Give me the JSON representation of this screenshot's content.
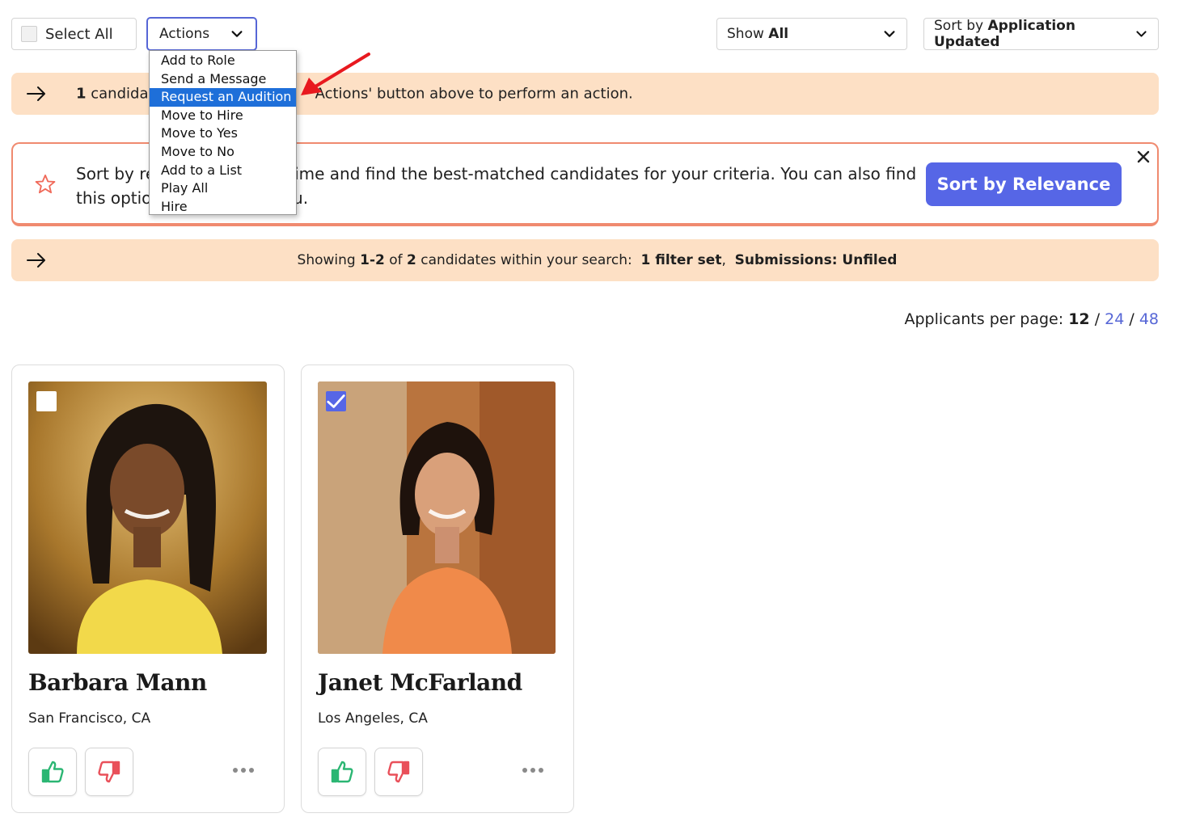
{
  "toolbar": {
    "select_all_label": "Select All",
    "actions_label": "Actions",
    "show_label_prefix": "Show ",
    "show_label_value": "All",
    "sort_label_prefix": "Sort by ",
    "sort_label_value": "Application Updated"
  },
  "actions_menu": {
    "items": [
      "Add to Role",
      "Send a Message",
      "Request an Audition",
      "Move to Hire",
      "Move to Yes",
      "Move to No",
      "Add to a List",
      "Play All",
      "Hire"
    ],
    "highlighted_index": 2
  },
  "selection_banner": {
    "count": "1",
    "text_before": " candidate",
    "text_after": "Actions' button above to perform an action."
  },
  "relevance_banner": {
    "text_line1": "Sort by relevance to save time and find the best-matched candidates for your criteria. You can also find",
    "text_line2": "this option in the Sort menu.",
    "button_label": "Sort by Relevance"
  },
  "results_banner": {
    "prefix": "Showing ",
    "range": "1-2",
    "of": " of ",
    "total": "2",
    "middle": " candidates within your search:  ",
    "filters": "1 filter set",
    "comma": ",  ",
    "submissions": "Submissions: Unfiled"
  },
  "per_page": {
    "label": "Applicants per page: ",
    "current": "12",
    "sep": " / ",
    "opt2": "24",
    "opt3": "48"
  },
  "candidates": [
    {
      "name": "Barbara Mann",
      "location": "San Francisco, CA",
      "selected": false
    },
    {
      "name": "Janet McFarland",
      "location": "Los Angeles, CA",
      "selected": true
    }
  ],
  "colors": {
    "accent": "#5666e6",
    "banner_bg": "#fde0c5",
    "relevance_border": "#f08a6f",
    "menu_highlight": "#1e6fd9",
    "thumb_up": "#2bb673",
    "thumb_down": "#e9505a"
  }
}
